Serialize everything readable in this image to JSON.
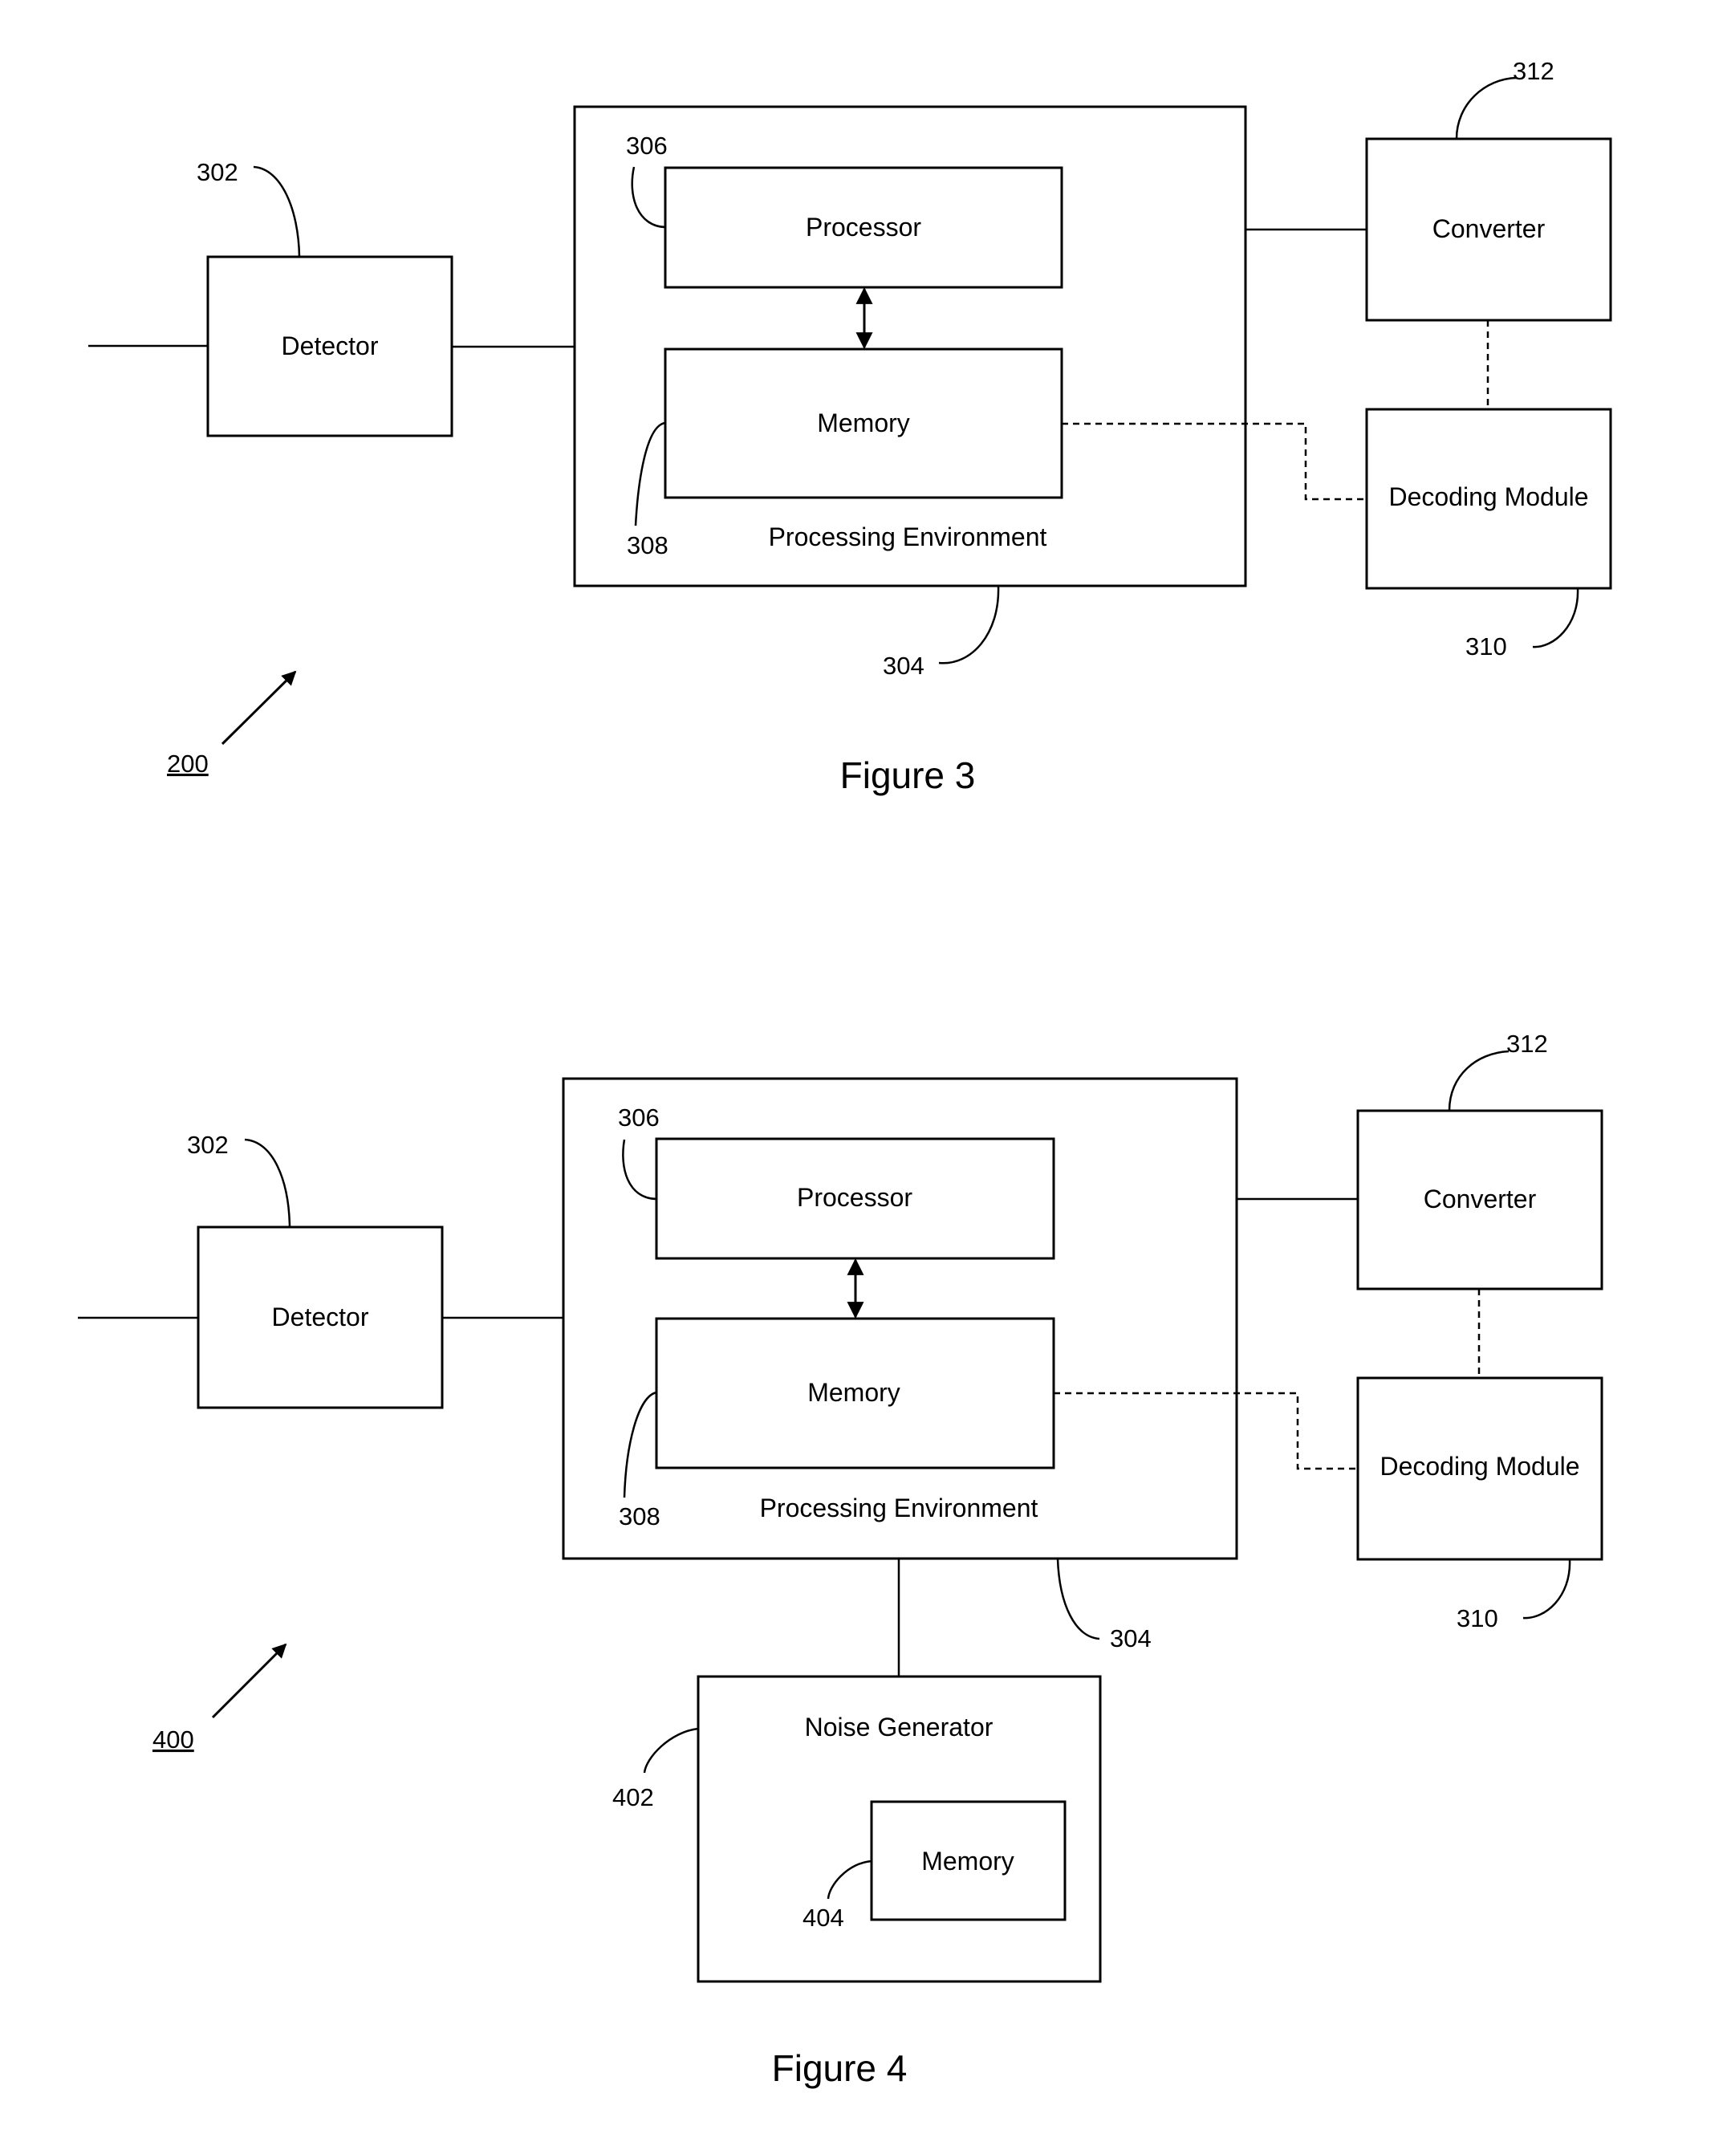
{
  "figures": [
    {
      "caption": "Figure 3",
      "reference": "200",
      "blocks": {
        "detector": {
          "label": "Detector",
          "ref": "302"
        },
        "processing_environment": {
          "label": "Processing Environment",
          "ref": "304"
        },
        "processor": {
          "label": "Processor",
          "ref": "306"
        },
        "memory": {
          "label": "Memory",
          "ref": "308"
        },
        "converter": {
          "label": "Converter",
          "ref": "312"
        },
        "decoding_module": {
          "label": "Decoding Module",
          "ref": "310"
        }
      },
      "connections": [
        {
          "from": "input",
          "to": "detector",
          "style": "solid"
        },
        {
          "from": "detector",
          "to": "processing_environment",
          "style": "solid"
        },
        {
          "from": "processor",
          "to": "memory",
          "style": "bidirectional-arrow"
        },
        {
          "from": "processing_environment",
          "to": "converter",
          "style": "solid"
        },
        {
          "from": "converter",
          "to": "decoding_module",
          "style": "dashed"
        },
        {
          "from": "memory",
          "to": "decoding_module",
          "style": "dashed"
        }
      ]
    },
    {
      "caption": "Figure 4",
      "reference": "400",
      "blocks": {
        "detector": {
          "label": "Detector",
          "ref": "302"
        },
        "processing_environment": {
          "label": "Processing Environment",
          "ref": "304"
        },
        "processor": {
          "label": "Processor",
          "ref": "306"
        },
        "memory": {
          "label": "Memory",
          "ref": "308"
        },
        "converter": {
          "label": "Converter",
          "ref": "312"
        },
        "decoding_module": {
          "label": "Decoding Module",
          "ref": "310"
        },
        "noise_generator": {
          "label": "Noise Generator",
          "ref": "402"
        },
        "noise_memory": {
          "label": "Memory",
          "ref": "404"
        }
      },
      "connections": [
        {
          "from": "input",
          "to": "detector",
          "style": "solid"
        },
        {
          "from": "detector",
          "to": "processing_environment",
          "style": "solid"
        },
        {
          "from": "processor",
          "to": "memory",
          "style": "bidirectional-arrow"
        },
        {
          "from": "processing_environment",
          "to": "converter",
          "style": "solid"
        },
        {
          "from": "converter",
          "to": "decoding_module",
          "style": "dashed"
        },
        {
          "from": "memory",
          "to": "decoding_module",
          "style": "dashed"
        },
        {
          "from": "processing_environment",
          "to": "noise_generator",
          "style": "solid"
        }
      ]
    }
  ]
}
